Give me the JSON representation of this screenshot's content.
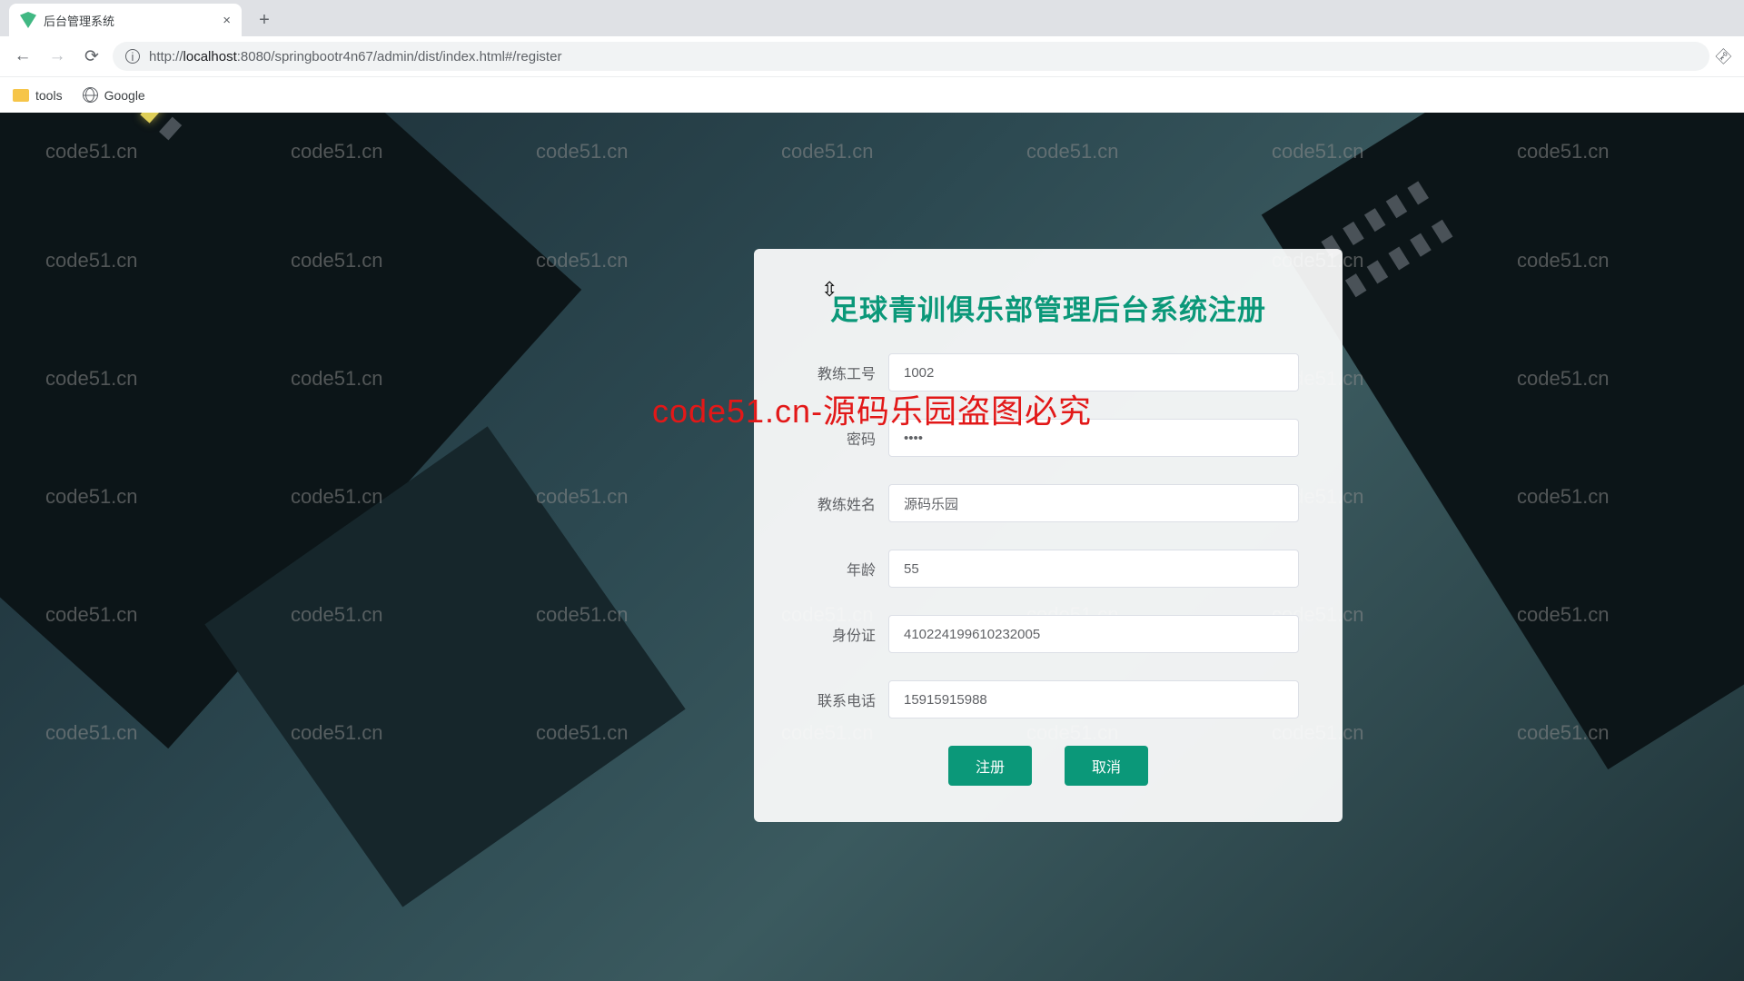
{
  "browser": {
    "tab_title": "后台管理系统",
    "url_prefix": "http://",
    "url_host": "localhost",
    "url_path": ":8080/springbootr4n67/admin/dist/index.html#/register",
    "bookmarks": {
      "tools": "tools",
      "google": "Google"
    }
  },
  "watermark": "code51.cn",
  "center_overlay": "code51.cn-源码乐园盗图必究",
  "form": {
    "title": "足球青训俱乐部管理后台系统注册",
    "fields": {
      "coach_id": {
        "label": "教练工号",
        "value": "1002"
      },
      "password": {
        "label": "密码",
        "value": "••••"
      },
      "coach_name": {
        "label": "教练姓名",
        "value": "源码乐园"
      },
      "age": {
        "label": "年龄",
        "value": "55"
      },
      "id_card": {
        "label": "身份证",
        "value": "410224199610232005"
      },
      "phone": {
        "label": "联系电话",
        "value": "15915915988"
      }
    },
    "buttons": {
      "register": "注册",
      "cancel": "取消"
    }
  }
}
